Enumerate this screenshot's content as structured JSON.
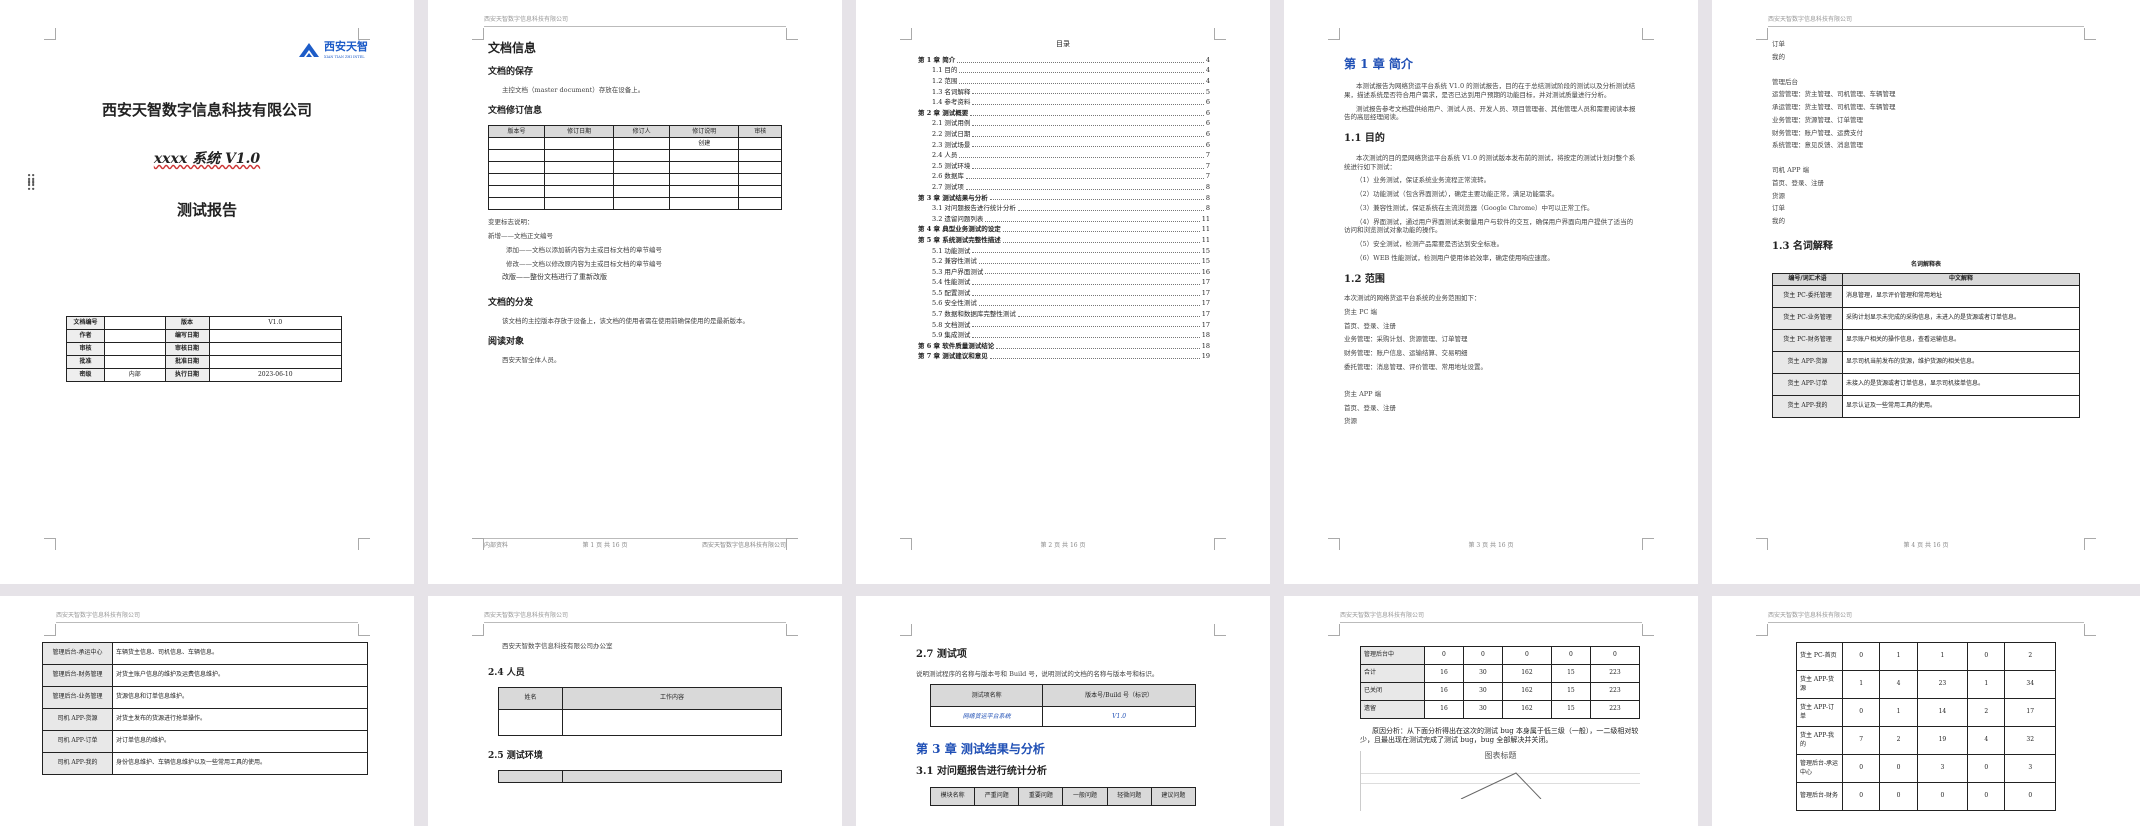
{
  "cover": {
    "logo_text": "西安天智",
    "logo_sub": "XIAN TIAN ZHI INTEL",
    "company": "西安天智数字信息科技有限公司",
    "system": "xxxx 系统 V1.0",
    "report": "测试报告",
    "info_rows": [
      [
        "文档编号",
        "",
        "版本",
        "V1.0"
      ],
      [
        "作者",
        "",
        "编写日期",
        ""
      ],
      [
        "审核",
        "",
        "审核日期",
        ""
      ],
      [
        "批准",
        "",
        "批准日期",
        ""
      ],
      [
        "密级",
        "内部",
        "执行日期",
        "2023-06-10"
      ]
    ]
  },
  "docinfo": {
    "header": "西安天智数字信息科技有限公司",
    "title": "文档信息",
    "sec_save": "文档的保存",
    "save_text": "主控文档（master document）存放在设备上。",
    "sec_revision": "文档修订信息",
    "rev_headers": [
      "版本号",
      "修订日期",
      "修订人",
      "修订说明",
      "审核"
    ],
    "rev_first_note": "创建",
    "change_label": "变更标志说明：",
    "change_lines": [
      "新增——文档正文编号",
      "添加——文档以添加新内容为主或目标文档的章节编号",
      "修改——文档以修改原内容为主或目标文档的章节编号",
      "改版——整份文档进行了重新改版"
    ],
    "sec_dist": "文档的分发",
    "dist_text": "该文档的主控版本存放于设备上，该文档的使用者需在使用前确保使用的是最新版本。",
    "sec_reader": "阅读对象",
    "reader_text": "西安天智全体人员。",
    "footer_left": "内部资料",
    "footer_mid": "第 1 页 共 16 页",
    "footer_right": "西安天智数字信息科技有限公司"
  },
  "toc": {
    "title": "目录",
    "items": [
      {
        "t": "第 1 章 简介",
        "p": "4",
        "lvl": 1
      },
      {
        "t": "1.1 目的",
        "p": "4",
        "lvl": 2
      },
      {
        "t": "1.2 范围",
        "p": "4",
        "lvl": 2
      },
      {
        "t": "1.3 名词解释",
        "p": "5",
        "lvl": 2
      },
      {
        "t": "1.4 参考资料",
        "p": "6",
        "lvl": 2
      },
      {
        "t": "第 2 章 测试概要",
        "p": "6",
        "lvl": 1
      },
      {
        "t": "2.1 测试用例",
        "p": "6",
        "lvl": 2
      },
      {
        "t": "2.2 测试日期",
        "p": "6",
        "lvl": 2
      },
      {
        "t": "2.3 测试场景",
        "p": "6",
        "lvl": 2
      },
      {
        "t": "2.4 人员",
        "p": "7",
        "lvl": 2
      },
      {
        "t": "2.5 测试环境",
        "p": "7",
        "lvl": 2
      },
      {
        "t": "2.6 数据库",
        "p": "7",
        "lvl": 2
      },
      {
        "t": "2.7 测试项",
        "p": "8",
        "lvl": 2
      },
      {
        "t": "第 3 章 测试结果与分析",
        "p": "8",
        "lvl": 1
      },
      {
        "t": "3.1 对问题报告进行统计分析",
        "p": "8",
        "lvl": 2
      },
      {
        "t": "3.2 遗留问题列表",
        "p": "11",
        "lvl": 2
      },
      {
        "t": "第 4 章 典型业务测试的设定",
        "p": "11",
        "lvl": 1
      },
      {
        "t": "第 5 章 系统测试完整性描述",
        "p": "11",
        "lvl": 1
      },
      {
        "t": "5.1 功能测试",
        "p": "15",
        "lvl": 2
      },
      {
        "t": "5.2 兼容性测试",
        "p": "15",
        "lvl": 2
      },
      {
        "t": "5.3 用户界面测试",
        "p": "16",
        "lvl": 2
      },
      {
        "t": "5.4 性能测试",
        "p": "17",
        "lvl": 2
      },
      {
        "t": "5.5 配置测试",
        "p": "17",
        "lvl": 2
      },
      {
        "t": "5.6 安全性测试",
        "p": "17",
        "lvl": 2
      },
      {
        "t": "5.7 数据和数据库完整性测试",
        "p": "17",
        "lvl": 2
      },
      {
        "t": "5.8 文档测试",
        "p": "17",
        "lvl": 2
      },
      {
        "t": "5.9 集成测试",
        "p": "18",
        "lvl": 2
      },
      {
        "t": "第 6 章 软件质量测试结论",
        "p": "18",
        "lvl": 1
      },
      {
        "t": "第 7 章 测试建议和意见",
        "p": "19",
        "lvl": 1
      }
    ],
    "footer_mid": "第 2 页 共 16 页"
  },
  "intro": {
    "chapter": "第 1 章 简介",
    "p1": "本测试报告为网络货运平台系统 V1.0 的测试报告，目的在于总结测试阶段的测试以及分析测试结果，描述系统是否符合用户需求，是否已达到用户预期的功能目标，并对测试质量进行分析。",
    "p2": "测试报告参考文档提供给用户、测试人员、开发人员、项目管理者、其他管理人员和需要阅读本报告的高层经理阅读。",
    "s11": "1.1 目的",
    "p3": "本次测试的目的是网络货运平台系统 V1.0 的测试版本发布前的测试，将按定的测试计划对整个系统进行如下测试：",
    "items": [
      "（1）业务测试，保证系统业务流程正常流转。",
      "（2）功能测试（包含界面测试），确定主要功能正常，满足功能需求。",
      "（3）兼容性测试，保证系统在主流浏览器（Google Chrome）中可以正常工作。",
      "（4）界面测试，通过用户界面测试来衡量用户与软件的交互，确保用户界面向用户提供了适当的访问和浏览测试对象功能的操作。",
      "（5）安全测试，检测产品需要是否达到安全标准。",
      "（6）WEB 性能测试，检测用户使用体验效率，确定使用响应速度。"
    ],
    "s12": "1.2 范围",
    "p4": "本次测试的网络货运平台系统的业务范围如下：",
    "scope": [
      "货主 PC 端",
      "首页、登录、注册",
      "业务管理：采购计划、货源管理、订单管理",
      "财务管理：账户信息、运输结算、交易明细",
      "委托管理：消息管理、评价管理、常用地址设置。",
      "",
      "货主 APP 端",
      "首页、登录、注册",
      "货源"
    ],
    "footer_mid": "第 3 页 共 16 页"
  },
  "terms": {
    "top_lines": [
      "订单",
      "我的",
      "",
      "管理后台",
      "运营管理：货主管理、司机管理、车辆管理",
      "承运管理：货主管理、司机管理、车辆管理",
      "业务管理：货源管理、订单管理",
      "财务管理：账户管理、运费支付",
      "系统管理：意见反馈、消息管理",
      "",
      "司机 APP 端",
      "首页、登录、注册",
      "货源",
      "订单",
      "我的"
    ],
    "s13": "1.3 名词解释",
    "table_title": "名词解释表",
    "headers": [
      "编号/词汇术语",
      "中文解释"
    ],
    "rows": [
      [
        "货主 PC-委托管理",
        "消息管理，显示评价管理和常用地址"
      ],
      [
        "货主 PC-业务管理",
        "采购计划显示未完成的采购信息，未进入的是货源或者订单信息。"
      ],
      [
        "货主 PC-财务管理",
        "显示账户相关的操作信息，查看运输信息。"
      ],
      [
        "货主 APP-货源",
        "显示司机当前发布的货源，维护货源的相关信息。"
      ],
      [
        "货主 APP-订单",
        "未接入的是货源或者订单信息，显示司机接单信息。"
      ],
      [
        "货主 APP-我的",
        "显示认证及一些常用工具的使用。"
      ]
    ],
    "footer_mid": "第 4 页 共 16 页"
  },
  "p6": {
    "rows": [
      [
        "管理后台-承运中心",
        "车辆货主信息、司机信息、车辆信息。"
      ],
      [
        "管理后台-财务管理",
        "对货主账户信息的维护及运费信息维护。"
      ],
      [
        "管理后台-业务管理",
        "货源信息和订单信息维护。"
      ],
      [
        "司机 APP-货源",
        "对货主发布的货源进行抢单操作。"
      ],
      [
        "司机 APP-订单",
        "对订单信息的维护。"
      ],
      [
        "司机 APP-我的",
        "身份信息维护、车辆信息维护以及一些常用工具的使用。"
      ]
    ]
  },
  "p7": {
    "top_text": "西安天智数字信息科技有限公司办公室",
    "s24": "2.4 人员",
    "headers": [
      "姓名",
      "工作内容"
    ],
    "s25": "2.5 测试环境"
  },
  "p8": {
    "s27": "2.7 测试项",
    "p": "说明测试程序的名称与版本号和 Build 号，说明测试的文档的名称与版本号和标识。",
    "headers": [
      "测试项名称",
      "版本号/Build 号（标识）"
    ],
    "row": [
      "网络货运平台系统",
      "V1.0"
    ],
    "chapter": "第 3 章 测试结果与分析",
    "s31": "3.1 对问题报告进行统计分析",
    "stat_headers": [
      "模块名称",
      "严重问题",
      "重要问题",
      "一般问题",
      "轻微问题",
      "建议问题"
    ]
  },
  "p9": {
    "rows": [
      [
        "管理后台中",
        "0",
        "0",
        "0",
        "0",
        "0"
      ],
      [
        "合计",
        "16",
        "30",
        "162",
        "15",
        "223"
      ],
      [
        "已关闭",
        "16",
        "30",
        "162",
        "15",
        "223"
      ],
      [
        "遗留",
        "16",
        "30",
        "162",
        "15",
        "223"
      ]
    ],
    "analysis": "原因分析：从下面分析得出在这次的测试 bug 本身属于低三级（一般），一二级相对较少，且最出现在测试完成了测试 bug，bug 全部解决并关闭。",
    "chart_title": "图表标题"
  },
  "p10": {
    "rows": [
      [
        "货主 PC-首页",
        "0",
        "1",
        "1",
        "0",
        "2"
      ],
      [
        "货主 APP-货源",
        "1",
        "4",
        "23",
        "1",
        "34"
      ],
      [
        "货主 APP-订单",
        "0",
        "1",
        "14",
        "2",
        "17"
      ],
      [
        "货主 APP-我的",
        "7",
        "2",
        "19",
        "4",
        "32"
      ],
      [
        "管理后台-承运中心",
        "0",
        "0",
        "3",
        "0",
        "3"
      ],
      [
        "管理后台-财务",
        "0",
        "0",
        "0",
        "0",
        "0"
      ]
    ]
  },
  "colors": {
    "heading_blue": "#1f4fb5",
    "logo_blue": "#1d5cc8",
    "page_bg": "#e6e3e8"
  }
}
